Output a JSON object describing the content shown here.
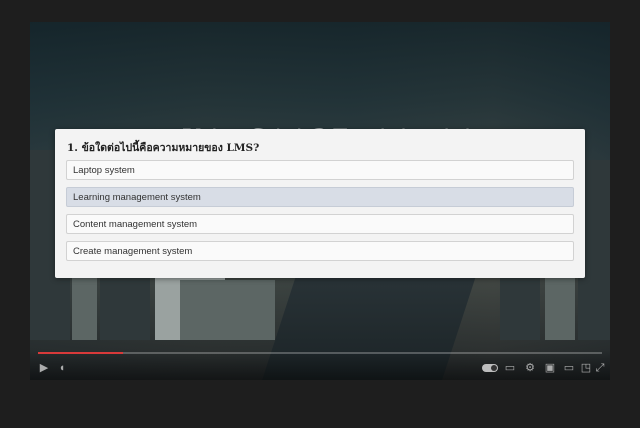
{
  "quiz": {
    "question": "1. ข้อใดต่อไปนี้คือความหมายของ LMS?",
    "options": [
      {
        "label": "Laptop system",
        "selected": false
      },
      {
        "label": "Learning management system",
        "selected": true
      },
      {
        "label": "Content management system",
        "selected": false
      },
      {
        "label": "Create management system",
        "selected": false
      }
    ]
  },
  "player": {
    "progress_fraction": 0.15,
    "icons": {
      "play": "play-icon",
      "volume": "volume-icon",
      "autoplay": "autoplay-toggle",
      "subtitles": "subtitles-icon",
      "settings": "gear-icon",
      "miniplayer": "miniplayer-icon",
      "theater": "theater-icon",
      "cast": "cast-icon",
      "fullscreen": "fullscreen-icon"
    }
  },
  "colors": {
    "progress": "#d83a3a",
    "selected_option": "#d8dde6",
    "quiz_background": "#f3f3f3"
  }
}
